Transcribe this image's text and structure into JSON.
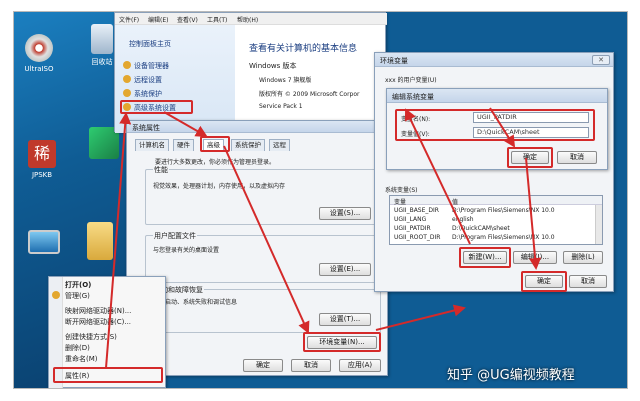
{
  "desktop": {
    "icons": [
      {
        "label": "UltraISO",
        "icon": "disc-icon"
      },
      {
        "label": "回收站",
        "icon": "recycle-bin-icon"
      },
      {
        "label": "JPSKB",
        "icon": "red-app-icon"
      },
      {
        "label": "",
        "icon": "green-app-icon"
      },
      {
        "label": "",
        "icon": "computer-icon"
      },
      {
        "label": "",
        "icon": "folder-icon"
      }
    ]
  },
  "control_panel": {
    "menu": [
      "文件(F)",
      "编辑(E)",
      "查看(V)",
      "工具(T)",
      "帮助(H)"
    ],
    "sidebar_home": "控制面板主页",
    "sidebar_links": [
      "设备管理器",
      "远程设置",
      "系统保护",
      "高级系统设置"
    ],
    "heading": "查看有关计算机的基本信息",
    "edition_label": "Windows 版本",
    "edition": "Windows 7 旗舰版",
    "copyright": "版权所有 © 2009 Microsoft Corpor",
    "service_pack": "Service Pack 1"
  },
  "system_properties": {
    "title": "系统属性",
    "tabs": [
      "计算机名",
      "硬件",
      "高级",
      "系统保护",
      "远程"
    ],
    "note": "要进行大多数更改，你必须作为管理员登录。",
    "performance": {
      "title": "性能",
      "desc": "视觉效果，处理器计划，内存使用，以及虚拟内存",
      "button": "设置(S)..."
    },
    "profiles": {
      "title": "用户配置文件",
      "desc": "与您登录有关的桌面设置",
      "button": "设置(E)..."
    },
    "startup": {
      "title": "启动和故障恢复",
      "desc": "系统启动、系统失败和调试信息",
      "button": "设置(T)..."
    },
    "env_button": "环境变量(N)...",
    "ok": "确定",
    "cancel": "取消",
    "apply": "应用(A)"
  },
  "env_vars": {
    "title": "环境变量",
    "user_vars_label": "xxx 的用户变量(U)",
    "system_label": "系统变量(S)",
    "col_var": "变量",
    "col_val": "值",
    "rows": [
      {
        "name": "UGII_BASE_DIR",
        "value": "D:\\Program Files\\Siemens\\NX 10.0"
      },
      {
        "name": "UGII_LANG",
        "value": "english"
      },
      {
        "name": "UGII_PATDIR",
        "value": "D:\\QuickCAM\\sheet"
      },
      {
        "name": "UGII_ROOT_DIR",
        "value": "D:\\Program Files\\Siemens\\NX 10.0"
      }
    ],
    "new_button": "新建(W)...",
    "edit_button": "编辑(I)...",
    "delete_button": "删除(L)",
    "ok": "确定",
    "cancel": "取消"
  },
  "edit_dialog": {
    "title": "编辑系统变量",
    "name_label": "变量名(N):",
    "name_value": "UGII_PATDIR",
    "value_label": "变量值(V):",
    "value_value": "D:\\QuickCAM\\sheet",
    "ok": "确定",
    "cancel": "取消"
  },
  "context_menu": {
    "items": [
      "打开(O)",
      "管理(G)",
      "映射网络驱动器(N)...",
      "断开网络驱动器(C)...",
      "创建快捷方式(S)",
      "删除(D)",
      "重命名(M)",
      "属性(R)"
    ]
  },
  "watermark": "知乎 @UG编视频教程",
  "colors": {
    "highlight": "#d42a2a",
    "desktop": "#0f5c94"
  }
}
